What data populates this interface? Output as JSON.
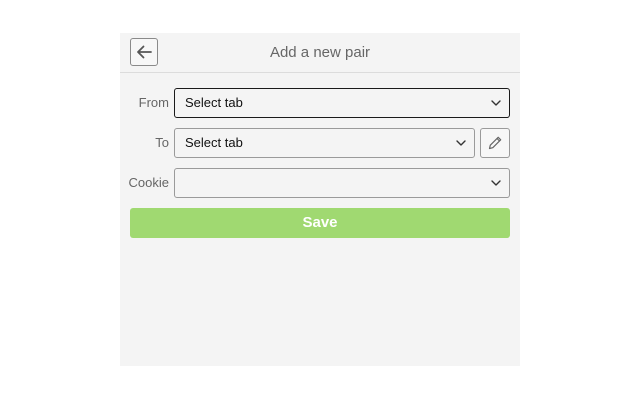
{
  "header": {
    "title": "Add a new pair",
    "back_icon": "arrow-left-icon"
  },
  "form": {
    "from": {
      "label": "From",
      "value": "Select tab"
    },
    "to": {
      "label": "To",
      "value": "Select tab",
      "edit_icon": "pencil-icon"
    },
    "cookie": {
      "label": "Cookie",
      "value": ""
    }
  },
  "actions": {
    "save_label": "Save",
    "save_color": "#a0d971"
  }
}
